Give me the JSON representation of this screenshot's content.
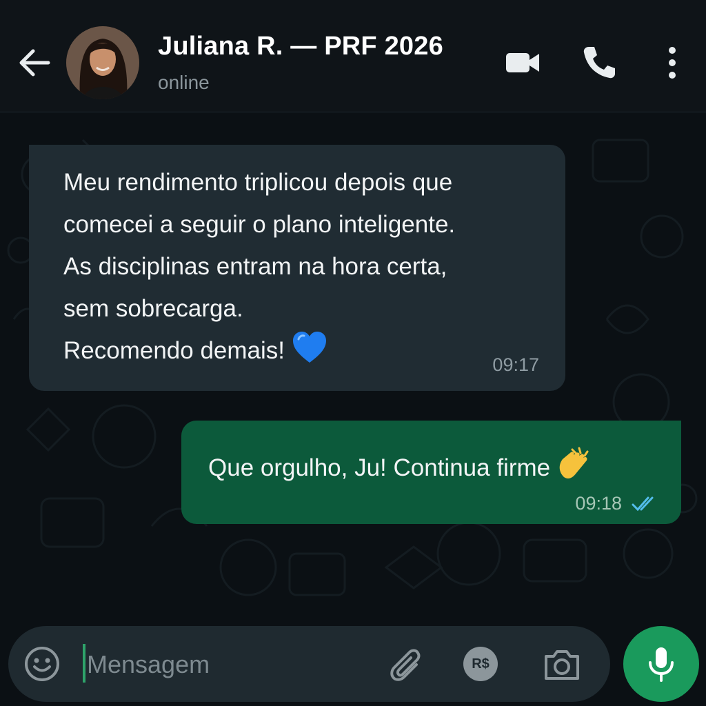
{
  "header": {
    "contact_name": "Juliana R. — PRF 2026",
    "status": "online"
  },
  "icons": {
    "back": "arrow-left-icon",
    "video": "video-camera-icon",
    "call": "phone-icon",
    "menu": "more-vertical-icon",
    "emoji": "smiley-icon",
    "attach": "paperclip-icon",
    "payment": "payment-icon",
    "camera": "camera-icon",
    "mic": "microphone-icon"
  },
  "messages": [
    {
      "direction": "incoming",
      "lines": [
        "Meu rendimento triplicou depois que",
        "comecei a seguir o plano inteligente.",
        "As disciplinas entram na hora certa,",
        "sem sobrecarga.",
        "Recomendo demais!"
      ],
      "emoji": "blue-heart",
      "time": "09:17"
    },
    {
      "direction": "outgoing",
      "text": "Que orgulho, Ju! Continua firme",
      "emoji": "clapping-hands",
      "time": "09:18",
      "status": "read"
    }
  ],
  "composer": {
    "placeholder": "Mensagem",
    "payment_label": "R$"
  },
  "colors": {
    "background": "#0b1014",
    "header": "#0f1418",
    "incoming_bubble": "#202c33",
    "outgoing_bubble": "#0c5a3b",
    "accent": "#1a9a5c",
    "read_ticks": "#53bdeb"
  }
}
